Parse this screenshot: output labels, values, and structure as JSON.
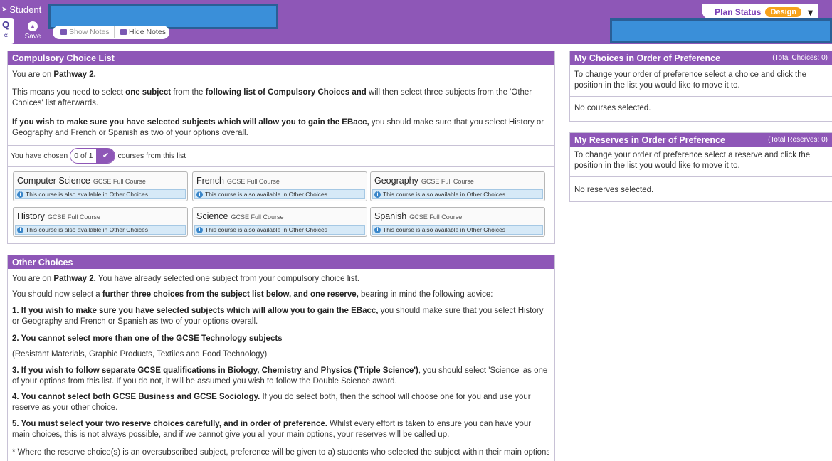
{
  "topbar": {
    "app_title": "Student",
    "save_label": "Save",
    "show_notes": "Show Notes",
    "hide_notes": "Hide Notes",
    "plan_status_label": "Plan Status",
    "plan_status_value": "Design",
    "colors": {
      "brand": "#8e57b7",
      "status": "#f7a21b",
      "redaction": "#3a8fd9"
    }
  },
  "compulsory": {
    "title": "Compulsory Choice List",
    "p1_pre": "You are on ",
    "p1_bold": "Pathway 2.",
    "p2_pre": "This means you need to select ",
    "p2_b1": "one subject",
    "p2_mid": " from the ",
    "p2_b2": "following list of Compulsory Choices and",
    "p2_post": " will then select three subjects from the 'Other Choices' list afterwards.",
    "p3_bold": "If you wish to make sure you have selected subjects which will allow you to gain the EBacc,",
    "p3_post": " you should make sure that you select History or Geography and French or Spanish as two of your options overall.",
    "chosen_pre": "You have chosen",
    "chosen_count": "0 of 1",
    "chosen_post": "courses from this list",
    "courses": [
      {
        "name": "Computer Science",
        "type": "GCSE Full Course",
        "info": "This course is also available in Other Choices"
      },
      {
        "name": "French",
        "type": "GCSE Full Course",
        "info": "This course is also available in Other Choices"
      },
      {
        "name": "Geography",
        "type": "GCSE Full Course",
        "info": "This course is also available in Other Choices"
      },
      {
        "name": "History",
        "type": "GCSE Full Course",
        "info": "This course is also available in Other Choices"
      },
      {
        "name": "Science",
        "type": "GCSE Full Course",
        "info": "This course is also available in Other Choices"
      },
      {
        "name": "Spanish",
        "type": "GCSE Full Course",
        "info": "This course is also available in Other Choices"
      }
    ]
  },
  "other": {
    "title": "Other Choices",
    "l1_pre": "You are on ",
    "l1_bold": "Pathway 2.",
    "l1_post": " You have already selected one subject from your compulsory choice list.",
    "l2_pre": "You should now select a ",
    "l2_bold": "further three choices from the subject list below, and one reserve,",
    "l2_post": " bearing in mind the following advice:",
    "a1_bold": "1. If you wish to make sure you have selected subjects which will allow you to gain the EBacc,",
    "a1_post": " you should make sure that you select History or Geography and French or Spanish as two of your options overall.",
    "a2_bold": "2. You cannot select more than one of the GCSE Technology subjects",
    "a2_note": "(Resistant Materials, Graphic Products, Textiles and Food Technology)",
    "a3_bold": "3. If you wish to follow separate GCSE qualifications in Biology, Chemistry and  Physics ('Triple Science')",
    "a3_post": ", you should select 'Science' as one of your options from this list. If you do not, it will be assumed you wish to follow the Double Science award.",
    "a4_bold": "4. You cannot select both GCSE Business and GCSE Sociology.",
    "a4_post": "  If you do select both, then the school will choose one for you and use your reserve as your other choice.",
    "a5_bold": "5. You must select your two reserve choices carefully, and in order of preference.",
    "a5_post": " Whilst every effort is taken to ensure you can have your main choices, this is not always possible, and if we cannot give you all your main options, your reserves will be called up.",
    "footnote": "* Where the reserve choice(s) is an oversubscribed subject, preference will be given to a)  students who selected the subject within their main options and then b)"
  },
  "my_choices": {
    "title": "My Choices in Order of Preference",
    "total": "(Total Choices: 0)",
    "instruction": "To change your order of preference select a choice and click the position in the list you would like to move it to.",
    "empty": "No courses selected."
  },
  "my_reserves": {
    "title": "My Reserves in Order of Preference",
    "total": "(Total Reserves: 0)",
    "instruction": "To change your order of preference select a reserve and click the position in the list you would like to move it to.",
    "empty": "No reserves selected."
  }
}
